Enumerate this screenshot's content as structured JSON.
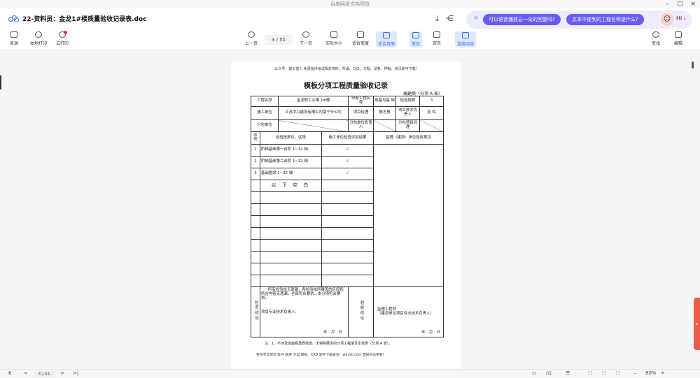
{
  "window": {
    "app_title": "百度网盘文档预览",
    "minimize": "–",
    "restore": "□",
    "close": "×"
  },
  "header": {
    "doc_title": "22-资料员：金龙1#楼质量验收记录表.doc",
    "download_icon": "download-icon",
    "share_icon": "share-icon"
  },
  "ai_bar": {
    "close": "×",
    "chip1": "可以语音播放云一朵的回复吗?",
    "chip2": "文本中提到的工程名称是什么?",
    "hi": "Hi ›"
  },
  "toolbar": {
    "catalog": "目录",
    "local_print": "本地打印",
    "cloud_print": "云打印",
    "prev_page": "上一页",
    "page_indicator": "3 / 51",
    "next_page": "下一页",
    "actual_size": "实际大小",
    "fit_width": "适合宽度",
    "fit_page": "适合页面",
    "single_page": "单页",
    "double_page": "双页",
    "continuous": "连续阅读",
    "find": "查找",
    "edit": "编辑"
  },
  "paper": {
    "top_note": "公众号：建工猎人 免费提供考试相关资料、背诵、口诀、习题、试卷、押题、资讯即可下载!",
    "title": "模板分项工程质量验收记录",
    "form_no": "编建质（分项 A 表）",
    "table": {
      "project_name_label": "工程名称",
      "project_name": "金龙职工公寓 1#楼",
      "sub_project_label": "分部工程名　称",
      "sub_project": "地基与基 础",
      "batch_count_label": "检验批数",
      "batch_count": "3",
      "builder_label": "施工单位",
      "builder": "江苏中兴建设有限公司南宁分公司",
      "pm_label": "项目经理",
      "pm": "殷志勇",
      "tech_lead_label": "项目技术负责人",
      "tech_lead": "吴 鸣",
      "subcontractor_label": "分包单位",
      "sub_lead_label": "分包单位负责人",
      "sub_pm_label": "分包项目经　理",
      "col_no": "序号",
      "col_part": "检验批部位、区段",
      "col_result": "施工单位检查评定结果",
      "col_opinion": "监理（建设）单位验收意见",
      "rows": [
        {
          "no": "1",
          "part": "阶梯基础第一台阶 1~32 轴",
          "result": "√"
        },
        {
          "no": "2",
          "part": "阶梯基础第二台阶 1~32 轴",
          "result": "√"
        },
        {
          "no": "3",
          "part": "基础圈梁 1~32 轴",
          "result": "√"
        }
      ],
      "blank_note": "以 下 空 白",
      "conclusion_label": "检查结论",
      "conclusion_text": "所有检验批无遗漏，各检验批所覆盖的区段和所含内容无遗漏，全部符合要求，本分项符合要求。",
      "tech_sign": "项目专业技术负责人：",
      "date1": "年　月　日",
      "accept_label": "验收结论",
      "supervisor": "监理工程师",
      "supervisor_note": "（建设单位项目专业技术负责人）",
      "date2": "年　月　日"
    },
    "bottom_note": "注：1、不涉及全面看重质检查、无特殊要求的分项工程填写本表表（分项 A 表）。",
    "bottom_note2": "更多考试资料 软件 题库 方案 模板、CAD 软件下载查询：wdzyk.com 直接点击更新!"
  },
  "statusbar": {
    "first": "K",
    "prev": "<",
    "page": "3 / 51",
    "next": ">",
    "last": ">|",
    "zoom_out": "–",
    "zoom": "80%",
    "zoom_in": "+"
  },
  "sidetab": "«",
  "colors": {
    "accent": "#2f6bff",
    "chip": "#6a5cf0",
    "sidetab": "#f05a4a"
  }
}
